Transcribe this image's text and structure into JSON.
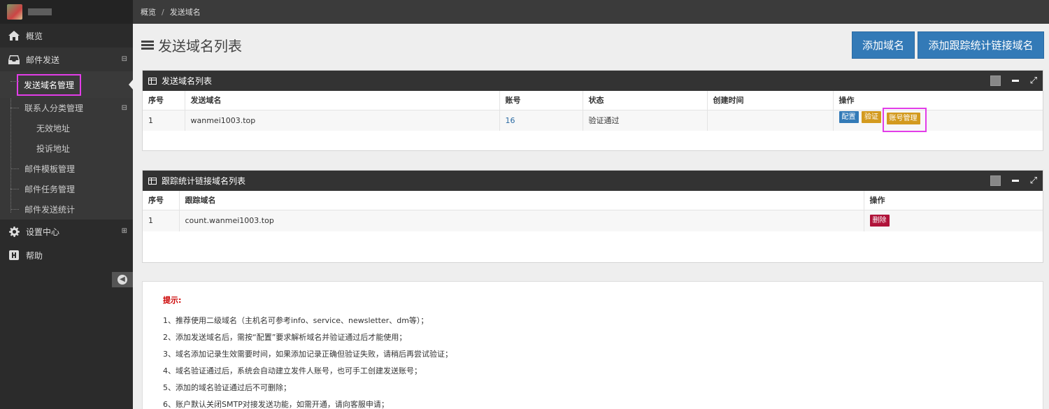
{
  "breadcrumb": {
    "home": "概览",
    "separator": "/",
    "current": "发送域名"
  },
  "sidebar": {
    "items": [
      {
        "label": "概览",
        "icon": "home-icon"
      },
      {
        "label": "邮件发送",
        "icon": "inbox-icon",
        "toggle": "⊟"
      },
      {
        "label": "设置中心",
        "icon": "gear-icon",
        "toggle": "⊞"
      },
      {
        "label": "帮助",
        "icon": "help-h-icon"
      }
    ],
    "submenu": [
      {
        "label": "发送域名管理"
      },
      {
        "label": "联系人分类管理",
        "toggle": "⊟"
      },
      {
        "label": "无效地址"
      },
      {
        "label": "投诉地址"
      },
      {
        "label": "邮件模板管理"
      },
      {
        "label": "邮件任务管理"
      },
      {
        "label": "邮件发送统计"
      }
    ]
  },
  "page": {
    "title": "发送域名列表",
    "add_domain_label": "添加域名",
    "add_tracking_label": "添加跟踪统计链接域名"
  },
  "send_panel": {
    "title": "发送域名列表",
    "columns": [
      "序号",
      "发送域名",
      "账号",
      "状态",
      "创建时间",
      "操作"
    ],
    "rows": [
      {
        "index": "1",
        "domain": "wanmei1003.top",
        "account": "16",
        "status": "验证通过",
        "created": ""
      }
    ],
    "actions": {
      "config": "配置",
      "verify": "验证",
      "account_mgmt": "账号管理"
    }
  },
  "track_panel": {
    "title": "跟踪统计链接域名列表",
    "columns": [
      "序号",
      "跟踪域名",
      "操作"
    ],
    "rows": [
      {
        "index": "1",
        "domain": "count.wanmei1003.top"
      }
    ],
    "actions": {
      "delete": "删除"
    }
  },
  "tips": {
    "title": "提示:",
    "lines": [
      "1、推荐使用二级域名（主机名可参考info、service、newsletter、dm等）；",
      "2、添加发送域名后，需按“配置”要求解析域名并验证通过后才能使用；",
      "3、域名添加记录生效需要时间，如果添加记录正确但验证失败，请稍后再尝试验证；",
      "4、域名验证通过后，系统会自动建立发件人账号，也可手工创建发送账号；",
      "5、添加的域名验证通过后不可删除；",
      "6、账户默认关闭SMTP对接发送功能，如需开通，请向客服申请；"
    ]
  },
  "colors": {
    "primary": "#337ab7",
    "warning": "#d39a1e",
    "danger": "#b0133a",
    "highlight": "#e23de8",
    "sidebar_bg": "#2b2b2b"
  }
}
